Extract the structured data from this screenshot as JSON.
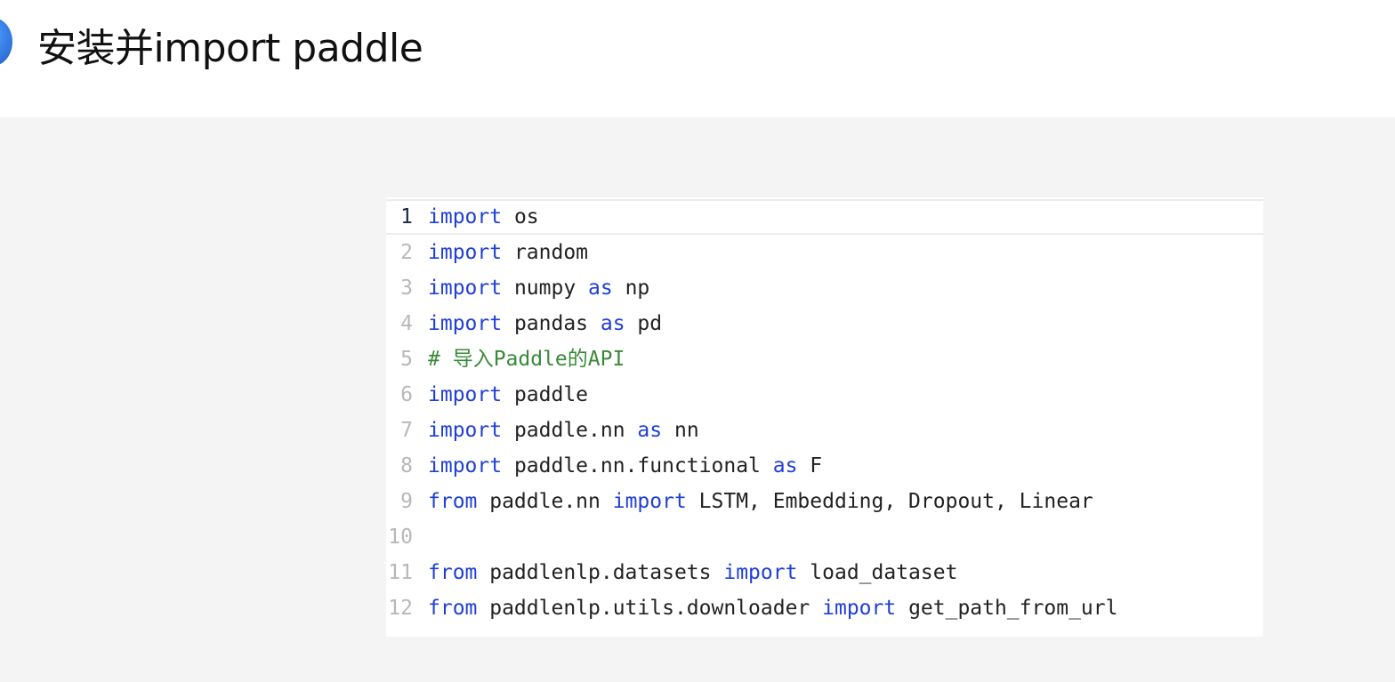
{
  "header": {
    "title": "安装并import paddle"
  },
  "colors": {
    "keyword": "#1f3fd6",
    "identifier": "#222222",
    "comment": "#3a8a3a",
    "line_number": "#b8b8b8",
    "active_line_number": "#1a2a44",
    "background": "#f4f4f4"
  },
  "code": {
    "active_line": 1,
    "lines": [
      {
        "number": "1",
        "tokens": [
          {
            "t": "kw",
            "v": "import"
          },
          {
            "t": "id",
            "v": " os"
          }
        ]
      },
      {
        "number": "2",
        "tokens": [
          {
            "t": "kw",
            "v": "import"
          },
          {
            "t": "id",
            "v": " random"
          }
        ]
      },
      {
        "number": "3",
        "tokens": [
          {
            "t": "kw",
            "v": "import"
          },
          {
            "t": "id",
            "v": " numpy "
          },
          {
            "t": "kw",
            "v": "as"
          },
          {
            "t": "id",
            "v": " np"
          }
        ]
      },
      {
        "number": "4",
        "tokens": [
          {
            "t": "kw",
            "v": "import"
          },
          {
            "t": "id",
            "v": " pandas "
          },
          {
            "t": "kw",
            "v": "as"
          },
          {
            "t": "id",
            "v": " pd"
          }
        ]
      },
      {
        "number": "5",
        "tokens": [
          {
            "t": "cm",
            "v": "# 导入Paddle的API"
          }
        ]
      },
      {
        "number": "6",
        "tokens": [
          {
            "t": "kw",
            "v": "import"
          },
          {
            "t": "id",
            "v": " paddle"
          }
        ]
      },
      {
        "number": "7",
        "tokens": [
          {
            "t": "kw",
            "v": "import"
          },
          {
            "t": "id",
            "v": " paddle.nn "
          },
          {
            "t": "kw",
            "v": "as"
          },
          {
            "t": "id",
            "v": " nn"
          }
        ]
      },
      {
        "number": "8",
        "tokens": [
          {
            "t": "kw",
            "v": "import"
          },
          {
            "t": "id",
            "v": " paddle.nn.functional "
          },
          {
            "t": "kw",
            "v": "as"
          },
          {
            "t": "id",
            "v": " F"
          }
        ]
      },
      {
        "number": "9",
        "tokens": [
          {
            "t": "kw",
            "v": "from"
          },
          {
            "t": "id",
            "v": " paddle.nn "
          },
          {
            "t": "kw",
            "v": "import"
          },
          {
            "t": "id",
            "v": " LSTM, Embedding, Dropout, Linear"
          }
        ]
      },
      {
        "number": "10",
        "tokens": []
      },
      {
        "number": "11",
        "tokens": [
          {
            "t": "kw",
            "v": "from"
          },
          {
            "t": "id",
            "v": " paddlenlp.datasets "
          },
          {
            "t": "kw",
            "v": "import"
          },
          {
            "t": "id",
            "v": " load_dataset"
          }
        ]
      },
      {
        "number": "12",
        "tokens": [
          {
            "t": "kw",
            "v": "from"
          },
          {
            "t": "id",
            "v": " paddlenlp.utils.downloader "
          },
          {
            "t": "kw",
            "v": "import"
          },
          {
            "t": "id",
            "v": " get_path_from_url"
          }
        ]
      }
    ]
  }
}
